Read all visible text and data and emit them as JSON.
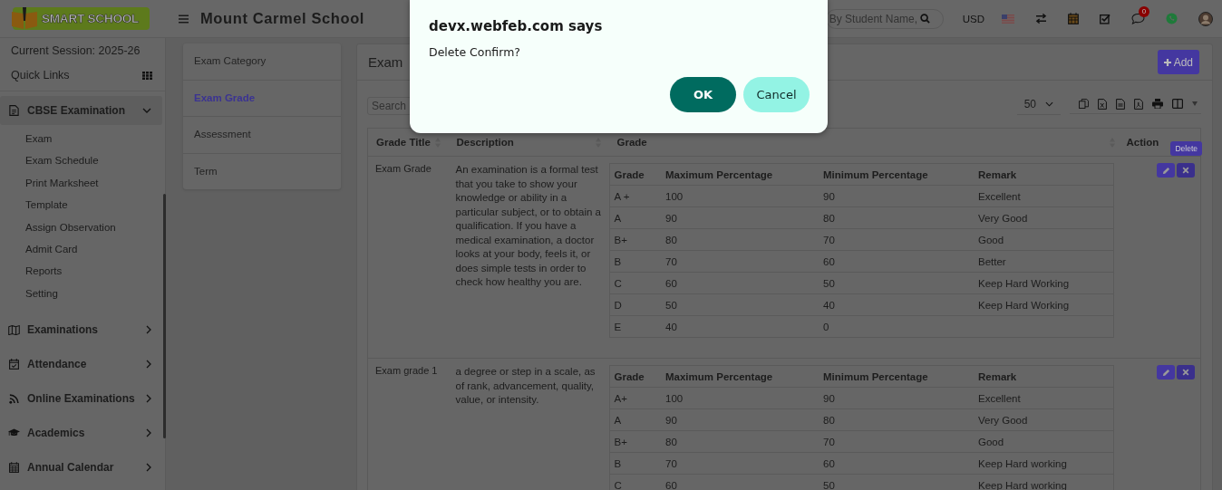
{
  "header": {
    "logo_text": "SMART SCHOOL",
    "school_name": "Mount Carmel School",
    "search": {
      "placeholder": "By Student Name,"
    },
    "currency": "USD",
    "notification_count": "0"
  },
  "sidebar": {
    "session": "Current Session: 2025-26",
    "quick_links": "Quick Links",
    "menu": [
      {
        "label": "CBSE Examination",
        "expanded": true,
        "children": [
          {
            "label": "Exam"
          },
          {
            "label": "Exam Schedule"
          },
          {
            "label": "Print Marksheet"
          },
          {
            "label": "Template"
          },
          {
            "label": "Assign Observation"
          },
          {
            "label": "Admit Card"
          },
          {
            "label": "Reports"
          },
          {
            "label": "Setting"
          }
        ]
      },
      {
        "label": "Examinations",
        "expanded": false
      },
      {
        "label": "Attendance",
        "expanded": false
      },
      {
        "label": "Online Examinations",
        "expanded": false
      },
      {
        "label": "Academics",
        "expanded": false
      },
      {
        "label": "Annual Calendar",
        "expanded": false
      }
    ]
  },
  "submenu": [
    {
      "label": "Exam Category",
      "selected": false
    },
    {
      "label": "Exam Grade",
      "selected": true
    },
    {
      "label": "Assessment",
      "selected": false
    },
    {
      "label": "Term",
      "selected": false
    }
  ],
  "panel": {
    "title": "Exam",
    "add_button": "Add",
    "search": {
      "placeholder": "Search"
    },
    "page_size": "50",
    "tooltip": "Delete",
    "table": {
      "columns": [
        "Grade Title",
        "Description",
        "Grade",
        "Action"
      ],
      "rows": [
        {
          "title": "Exam Grade",
          "description": "An examination is a formal test that you take to show your knowledge or ability in a particular subject, or to obtain a qualification. If you have a medical examination, a doctor looks at your body, feels it, or does simple tests in order to check how healthy you are.",
          "grades": {
            "columns": [
              "Grade",
              "Maximum Percentage",
              "Minimum Percentage",
              "Remark"
            ],
            "rows": [
              {
                "grade": "A +",
                "max": "100",
                "min": "90",
                "remark": "Excellent"
              },
              {
                "grade": "A",
                "max": "90",
                "min": "80",
                "remark": "Very Good"
              },
              {
                "grade": "B+",
                "max": "80",
                "min": "70",
                "remark": "Good"
              },
              {
                "grade": "B",
                "max": "70",
                "min": "60",
                "remark": "Better"
              },
              {
                "grade": "C",
                "max": "60",
                "min": "50",
                "remark": "Keep Hard Working"
              },
              {
                "grade": "D",
                "max": "50",
                "min": "40",
                "remark": "Keep Hard Working"
              },
              {
                "grade": "E",
                "max": "40",
                "min": "0"
              }
            ]
          }
        },
        {
          "title": "Exam grade 1",
          "description": "a degree or step in a scale, as of rank, advancement, quality, value, or intensity.",
          "grades": {
            "columns": [
              "Grade",
              "Maximum Percentage",
              "Minimum Percentage",
              "Remark"
            ],
            "rows": [
              {
                "grade": "A+",
                "max": "100",
                "min": "90",
                "remark": "Excellent"
              },
              {
                "grade": "A",
                "max": "90",
                "min": "80",
                "remark": "Very Good"
              },
              {
                "grade": "B+",
                "max": "80",
                "min": "70",
                "remark": "Good"
              },
              {
                "grade": "B",
                "max": "70",
                "min": "60",
                "remark": "Keep Hard working"
              },
              {
                "grade": "C",
                "max": "60",
                "min": "50",
                "remark": "Keep Hard working"
              }
            ]
          }
        }
      ]
    }
  },
  "dialog": {
    "title": "devx.webfeb.com says",
    "message": "Delete Confirm?",
    "buttons": [
      {
        "label": "OK",
        "kind": "primary"
      },
      {
        "label": "Cancel",
        "kind": "secondary"
      }
    ]
  }
}
